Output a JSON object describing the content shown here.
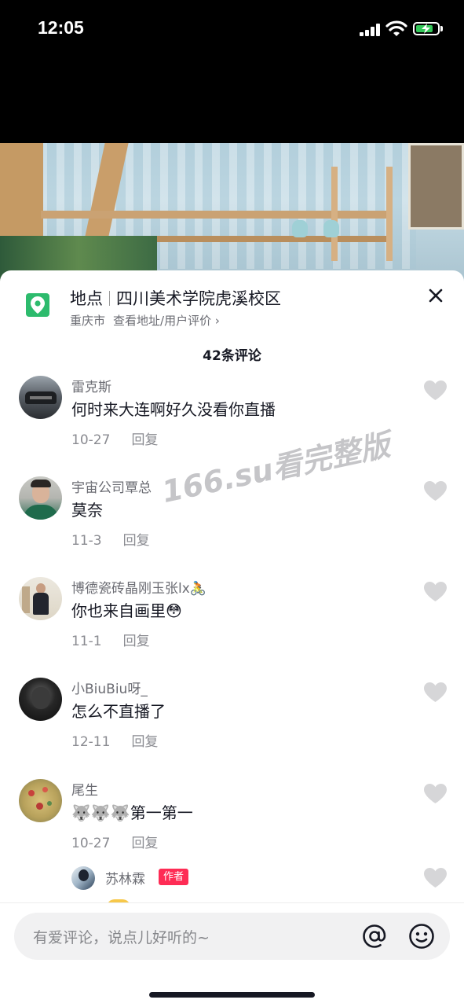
{
  "status_bar": {
    "time": "12:05"
  },
  "location": {
    "label": "地点",
    "name": "四川美术学院虎溪校区",
    "city": "重庆市",
    "link": "查看地址/用户评价 ›"
  },
  "comments_header": {
    "count_label": "42条评论"
  },
  "comments": [
    {
      "user": "雷克斯",
      "text": "何时来大连啊好久没看你直播",
      "date": "10-27",
      "reply": "回复"
    },
    {
      "user": "宇宙公司覃总",
      "text": "莫奈",
      "date": "11-3",
      "reply": "回复"
    },
    {
      "user": "博德瓷砖晶刚玉张lx🚴",
      "text": "你也来自画里😳",
      "date": "11-1",
      "reply": "回复"
    },
    {
      "user": "小BiuBiu呀_",
      "text": "怎么不直播了",
      "date": "12-11",
      "reply": "回复"
    },
    {
      "user": "尾生",
      "text": "🐺🐺🐺第一第一",
      "date": "10-27",
      "reply": "回复"
    }
  ],
  "author_reply": {
    "user": "苏林霖",
    "badge": "作者"
  },
  "input": {
    "placeholder": "有爱评论，说点儿好听的~"
  },
  "watermark": "166.su看完整版",
  "colors": {
    "accent": "#fe2c55",
    "location_green": "#2dbb6d",
    "battery_green": "#34c759"
  }
}
